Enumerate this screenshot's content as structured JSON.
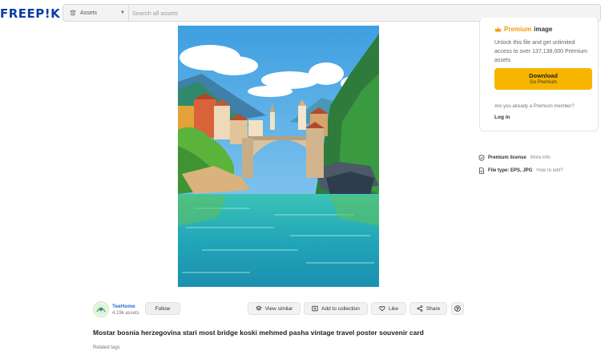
{
  "header": {
    "logo": "FREEP!K",
    "asset_type": "Assets",
    "search_placeholder": "Search all assets"
  },
  "premium": {
    "title_highlight": "Premium",
    "title_rest": "image",
    "description": "Unlock this file and get unlimited access to over 137,138,000 Premium assets",
    "download_label": "Download",
    "download_sub": "Go Premium",
    "member_question": "Are you already a Premium member?",
    "login_label": "Log in"
  },
  "license": {
    "label": "Premium license",
    "more_info": "More info"
  },
  "file_type": {
    "label": "File type: EPS, JPG",
    "how_to_edit": "How to edit?"
  },
  "author": {
    "name": "TeeHome",
    "assets": "4.19k assets",
    "follow_label": "Follow"
  },
  "actions": {
    "view_similar": "View similar",
    "add_to_collection": "Add to collection",
    "like": "Like",
    "share": "Share"
  },
  "asset_title": "Mostar bosnia herzegovina stari most bridge koski mehmed pasha vintage travel poster souvenir card",
  "related_tags": "Related tags",
  "colors": {
    "brand_blue": "#0d3ca8",
    "premium_orange": "#f29b05",
    "download_yellow": "#f7b500",
    "link_blue": "#2a6ed8"
  }
}
